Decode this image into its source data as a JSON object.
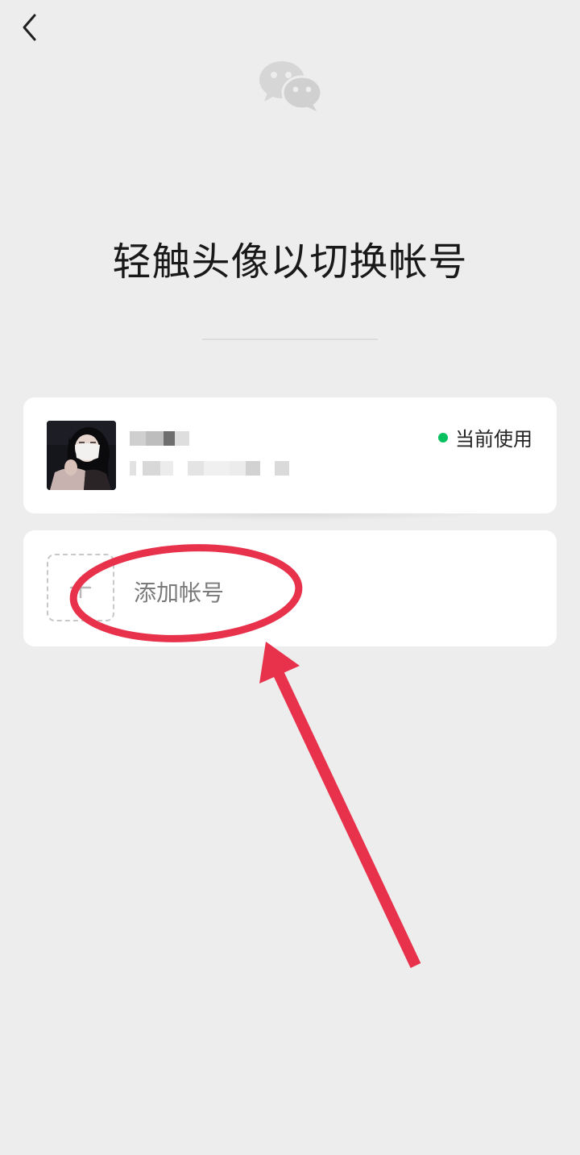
{
  "header": {
    "back_icon": "chevron-left-icon"
  },
  "brand": {
    "logo_icon": "wechat-logo-icon"
  },
  "page": {
    "title": "轻触头像以切换帐号"
  },
  "accounts": {
    "current": {
      "name_display": "",
      "id_display": "",
      "status_label": "当前使用",
      "status_color": "#07c160"
    },
    "add_account": {
      "label": "添加帐号",
      "icon": "plus-icon"
    }
  },
  "overlay": {
    "annotation_color": "#e8314b",
    "circle": "red-circle",
    "arrow": "red-arrow"
  }
}
